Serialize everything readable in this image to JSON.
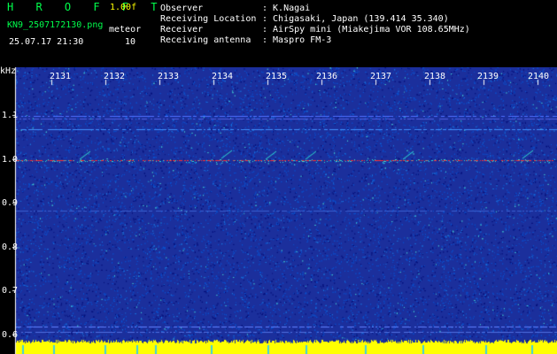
{
  "header": {
    "app_name": "H R O F F T",
    "version": "1.00f",
    "filename": "KN9_2507172130.png",
    "datetime": "25.07.17 21:30",
    "mode_label": "meteor",
    "mode_value": "10"
  },
  "station": {
    "rows": [
      {
        "label": "Observer",
        "value": ": K.Nagai"
      },
      {
        "label": "Receiving Location",
        "value": ": Chigasaki, Japan (139.414 35.340)"
      },
      {
        "label": "Receiver",
        "value": ": AirSpy mini (Miakejima VOR 108.65MHz)"
      },
      {
        "label": "Receiving antenna",
        "value": ": Maspro FM-3"
      }
    ]
  },
  "spectrogram": {
    "unit_label": "kHz",
    "freq_labels": [
      "1.1",
      "1.0",
      "0.9",
      "0.8",
      "0.7",
      "0.6"
    ],
    "time_labels": [
      "2131",
      "2132",
      "2133",
      "2134",
      "2135",
      "2136",
      "2137",
      "2138",
      "2139",
      "2140"
    ],
    "colors": {
      "background": "#1b2f9c",
      "noise": "#0a52d0",
      "signal": "#30e0d0",
      "carrier": "#ff3030",
      "level_bar": "#ffff00"
    }
  }
}
